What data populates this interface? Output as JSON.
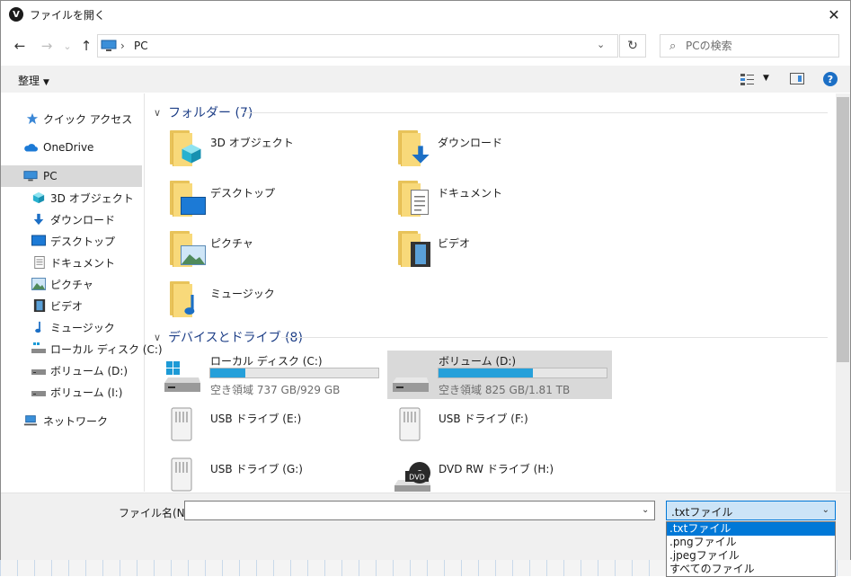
{
  "window": {
    "title": "ファイルを開く",
    "app_icon": "V"
  },
  "nav": {
    "back_glyph": "←",
    "forward_glyph": "→",
    "recent_glyph": "⌄",
    "up_glyph": "↑",
    "refresh_glyph": "↻",
    "address": "PC",
    "address_sep": "›",
    "search_placeholder": "PCの検索"
  },
  "toolbar": {
    "organize": "整理",
    "help": "?"
  },
  "sidebar": {
    "items": [
      {
        "label": "クイック アクセス",
        "icon": "star-icon"
      },
      {
        "label": "OneDrive",
        "icon": "cloud-icon"
      },
      {
        "label": "PC",
        "icon": "pc-icon",
        "selected": true
      },
      {
        "label": "3D オブジェクト",
        "icon": "cube-icon"
      },
      {
        "label": "ダウンロード",
        "icon": "download-icon"
      },
      {
        "label": "デスクトップ",
        "icon": "desktop-icon"
      },
      {
        "label": "ドキュメント",
        "icon": "document-icon"
      },
      {
        "label": "ピクチャ",
        "icon": "picture-icon"
      },
      {
        "label": "ビデオ",
        "icon": "video-icon"
      },
      {
        "label": "ミュージック",
        "icon": "music-icon"
      },
      {
        "label": "ローカル ディスク (C:)",
        "icon": "drive-icon"
      },
      {
        "label": "ボリューム (D:)",
        "icon": "drive-icon"
      },
      {
        "label": "ボリューム (I:)",
        "icon": "drive-icon"
      },
      {
        "label": "ネットワーク",
        "icon": "network-icon"
      }
    ]
  },
  "folders": {
    "header": "フォルダー (7)",
    "items": [
      {
        "label": "3D オブジェクト",
        "icon": "cube-icon"
      },
      {
        "label": "ダウンロード",
        "icon": "download-icon"
      },
      {
        "label": "デスクトップ",
        "icon": "desktop-icon"
      },
      {
        "label": "ドキュメント",
        "icon": "document-icon"
      },
      {
        "label": "ピクチャ",
        "icon": "picture-icon"
      },
      {
        "label": "ビデオ",
        "icon": "video-icon"
      },
      {
        "label": "ミュージック",
        "icon": "music-icon"
      }
    ]
  },
  "devices": {
    "header": "デバイスとドライブ (8)",
    "items": [
      {
        "label": "ローカル ディスク (C:)",
        "free": "空き領域 737 GB/929 GB",
        "used_fraction": 0.21
      },
      {
        "label": "ボリューム (D:)",
        "free": "空き領域 825 GB/1.81 TB",
        "used_fraction": 0.56,
        "selected": true
      },
      {
        "label": "USB ドライブ (E:)"
      },
      {
        "label": "USB ドライブ (F:)"
      },
      {
        "label": "USB ドライブ (G:)"
      },
      {
        "label": "DVD RW ドライブ (H:)",
        "badge": "DVD"
      }
    ]
  },
  "footer": {
    "filename_label": "ファイル名(N):",
    "filename_value": "",
    "file_type_selected": ".txtファイル",
    "file_type_options": [
      ".txtファイル",
      ".pngファイル",
      ".jpegファイル",
      "すべてのファイル"
    ]
  },
  "colors": {
    "accent": "#0078d7",
    "header_blue": "#1e3f87",
    "usage_bar": "#26a0da",
    "folder": "#f8d97a"
  }
}
